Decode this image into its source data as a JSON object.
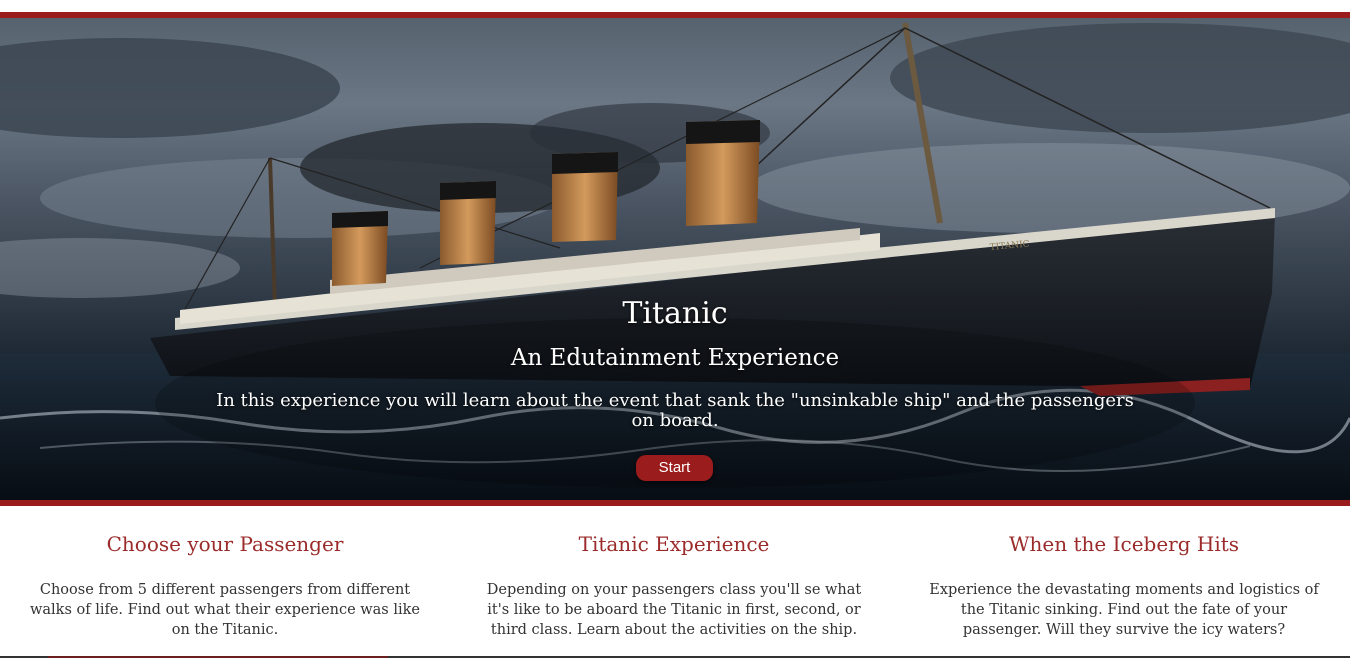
{
  "hero": {
    "title": "Titanic",
    "subtitle": "An Edutainment Experience",
    "description": "In this experience you will learn about the event that sank the \"unsinkable ship\" and the passengers on board.",
    "start_label": "Start",
    "hull_name": "TITANIC"
  },
  "features": [
    {
      "title": "Choose your Passenger",
      "text": "Choose from 5 different passengers from different walks of life. Find out what their experience was like on the Titanic."
    },
    {
      "title": "Titanic Experience",
      "text": "Depending on your passengers class you'll se what it's like to be aboard the Titanic in first, second, or third class. Learn about the activities on the ship."
    },
    {
      "title": "When the Iceberg Hits",
      "text": "Experience the devastating moments and logistics of the Titanic sinking. Find out the fate of your passenger. Will they survive the icy waters?"
    }
  ],
  "colors": {
    "accent": "#9b1c1c",
    "feature_title": "#9b2a2a",
    "body_text": "#333333"
  }
}
